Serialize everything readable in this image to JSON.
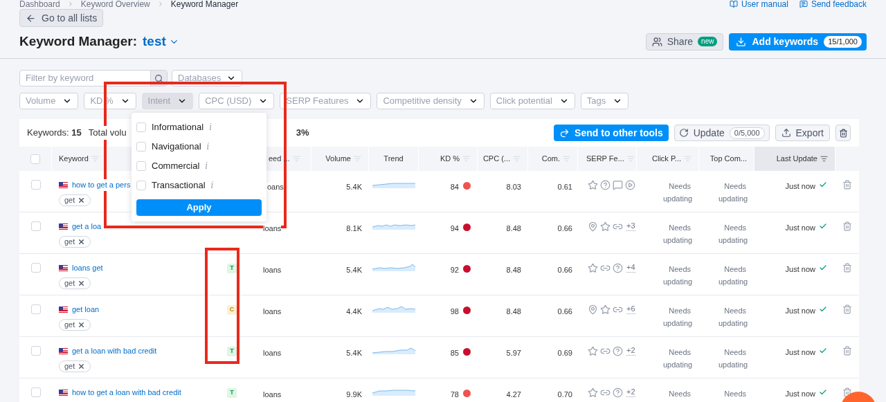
{
  "breadcrumbs": [
    "Dashboard",
    "Keyword Overview",
    "Keyword Manager"
  ],
  "top_links": [
    {
      "kind": "manual",
      "label": "User manual"
    },
    {
      "kind": "feedback",
      "label": "Send feedback"
    }
  ],
  "back_button": "Go to all lists",
  "title": {
    "label": "Keyword Manager:",
    "list_name": "test"
  },
  "share_button": {
    "label": "Share",
    "badge": "new"
  },
  "add_button": {
    "label": "Add keywords",
    "count": "15/1,000"
  },
  "search": {
    "placeholder": "Filter by keyword"
  },
  "databases_filter": "Databases",
  "filters": [
    {
      "label": "Volume",
      "selected": false
    },
    {
      "label": "KD %",
      "selected": false
    },
    {
      "label": "Intent",
      "selected": true
    },
    {
      "label": "CPC (USD)",
      "selected": false
    },
    {
      "label": "SERP Features",
      "selected": false
    },
    {
      "label": "Competitive density",
      "selected": false
    },
    {
      "label": "Click potential",
      "selected": false
    },
    {
      "label": "Tags",
      "selected": false
    }
  ],
  "intent_menu": {
    "options": [
      {
        "label": "Informational",
        "info": "i",
        "checked": false
      },
      {
        "label": "Navigational",
        "info": "i",
        "checked": false
      },
      {
        "label": "Commercial",
        "info": "i",
        "checked": false
      },
      {
        "label": "Transactional",
        "info": "i",
        "checked": false
      }
    ],
    "apply": "Apply"
  },
  "select_all_checked": false,
  "summary": {
    "keywords_label": "Keywords:",
    "keywords_value": "15",
    "total_label": "Total volu",
    "tail_value": "3%"
  },
  "toolbar": {
    "send": "Send to other tools",
    "update": "Update",
    "update_count": "0/5,000",
    "export": "Export"
  },
  "columns": [
    "Keyword",
    "eed ...",
    "Volume",
    "Trend",
    "KD %",
    "CPC (...",
    "Com.",
    "SERP Fe...",
    "Click P...",
    "Top Com...",
    "Last Update"
  ],
  "rows": [
    {
      "checked": false,
      "keyword": "how to get a pers",
      "tag": "get",
      "intent": null,
      "seed": "oans",
      "volume": "5.4K",
      "kd": "84",
      "color": "#ef5350",
      "cpc": "8.03",
      "com": "0.61",
      "serp": [
        {
          "kind": "star"
        },
        {
          "kind": "question"
        },
        {
          "kind": "comment"
        },
        {
          "kind": "play"
        }
      ],
      "serp_more": null,
      "click": "Needs updating",
      "top": "Needs updating",
      "updated": "Just now"
    },
    {
      "checked": false,
      "keyword": "get a loa",
      "tag": "get",
      "intent": null,
      "seed": "loans",
      "volume": "8.1K",
      "kd": "94",
      "color": "#c8102e",
      "cpc": "8.48",
      "com": "0.66",
      "serp": [
        {
          "kind": "pin"
        },
        {
          "kind": "star"
        },
        {
          "kind": "link"
        }
      ],
      "serp_more": "+3",
      "click": "Needs updating",
      "top": "Needs updating",
      "updated": "Just now"
    },
    {
      "checked": false,
      "keyword": "loans get",
      "tag": "get",
      "intent": {
        "label": "T",
        "kind": "transactional"
      },
      "seed": "loans",
      "volume": "5.4K",
      "kd": "92",
      "color": "#c8102e",
      "cpc": "8.48",
      "com": "0.66",
      "serp": [
        {
          "kind": "star"
        },
        {
          "kind": "link"
        },
        {
          "kind": "question"
        }
      ],
      "serp_more": "+4",
      "click": "Needs updating",
      "top": "Needs updating",
      "updated": "Just now"
    },
    {
      "checked": false,
      "keyword": "get loan",
      "tag": "get",
      "intent": {
        "label": "C",
        "kind": "commercial"
      },
      "seed": "loans",
      "volume": "4.4K",
      "kd": "98",
      "color": "#c8102e",
      "cpc": "8.48",
      "com": "0.66",
      "serp": [
        {
          "kind": "pin"
        },
        {
          "kind": "star"
        },
        {
          "kind": "link"
        }
      ],
      "serp_more": "+6",
      "click": "Needs updating",
      "top": "Needs updating",
      "updated": "Just now"
    },
    {
      "checked": false,
      "keyword": "get a loan with bad credit",
      "tag": "get",
      "intent": {
        "label": "T",
        "kind": "transactional"
      },
      "seed": "loans",
      "volume": "5.4K",
      "kd": "85",
      "color": "#c8102e",
      "cpc": "5.97",
      "com": "0.69",
      "serp": [
        {
          "kind": "star"
        },
        {
          "kind": "link"
        },
        {
          "kind": "question"
        }
      ],
      "serp_more": "+2",
      "click": "Needs updating",
      "top": "Needs updating",
      "updated": "Just now"
    },
    {
      "checked": false,
      "keyword": "how to get a loan with bad credit",
      "tag": null,
      "intent": {
        "label": "T",
        "kind": "transactional"
      },
      "seed": "loans",
      "volume": "9.9K",
      "kd": "78",
      "color": "#ef5350",
      "cpc": "4.27",
      "com": "0.70",
      "serp": [
        {
          "kind": "star"
        },
        {
          "kind": "link"
        },
        {
          "kind": "question"
        }
      ],
      "serp_more": "+2",
      "click": "Needs",
      "top": "Needs",
      "updated": "Just now"
    }
  ]
}
